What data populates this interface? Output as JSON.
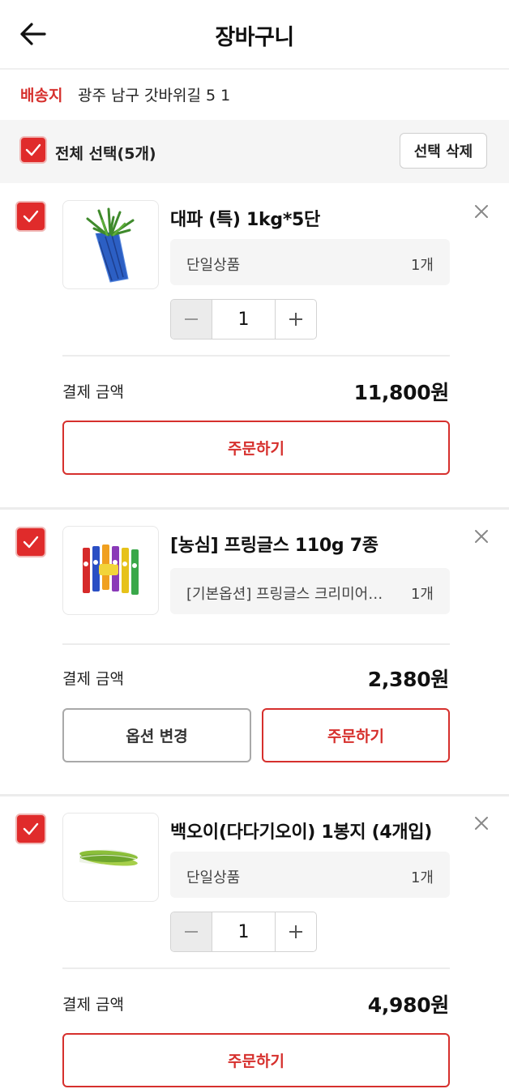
{
  "header": {
    "title": "장바구니",
    "back_icon": "arrow-left-icon"
  },
  "address": {
    "label": "배송지",
    "value": "광주 남구 갓바위길 5 1"
  },
  "select_bar": {
    "select_all_label": "전체 선택(5개)",
    "delete_selected_label": "선택 삭제"
  },
  "colors": {
    "accent": "#d6302d",
    "checkbox": "#e02b2b"
  },
  "items": [
    {
      "name": "대파 (특) 1kg*5단",
      "option": "단일상품",
      "option_qty": "1개",
      "quantity": "1",
      "pay_label": "결제 금액",
      "pay_amount": "11,800원",
      "order_label": "주문하기"
    },
    {
      "name": "[농심] 프링글스 110g 7종",
      "option": "[기본옵션] 프링글스 크리미어니언",
      "option_qty": "1개",
      "pay_label": "결제 금액",
      "pay_amount": "2,380원",
      "option_change_label": "옵션 변경",
      "order_label": "주문하기"
    },
    {
      "name": "백오이(다다기오이) 1봉지 (4개입)",
      "option": "단일상품",
      "option_qty": "1개",
      "quantity": "1",
      "pay_label": "결제 금액",
      "pay_amount": "4,980원",
      "order_label": "주문하기"
    }
  ]
}
